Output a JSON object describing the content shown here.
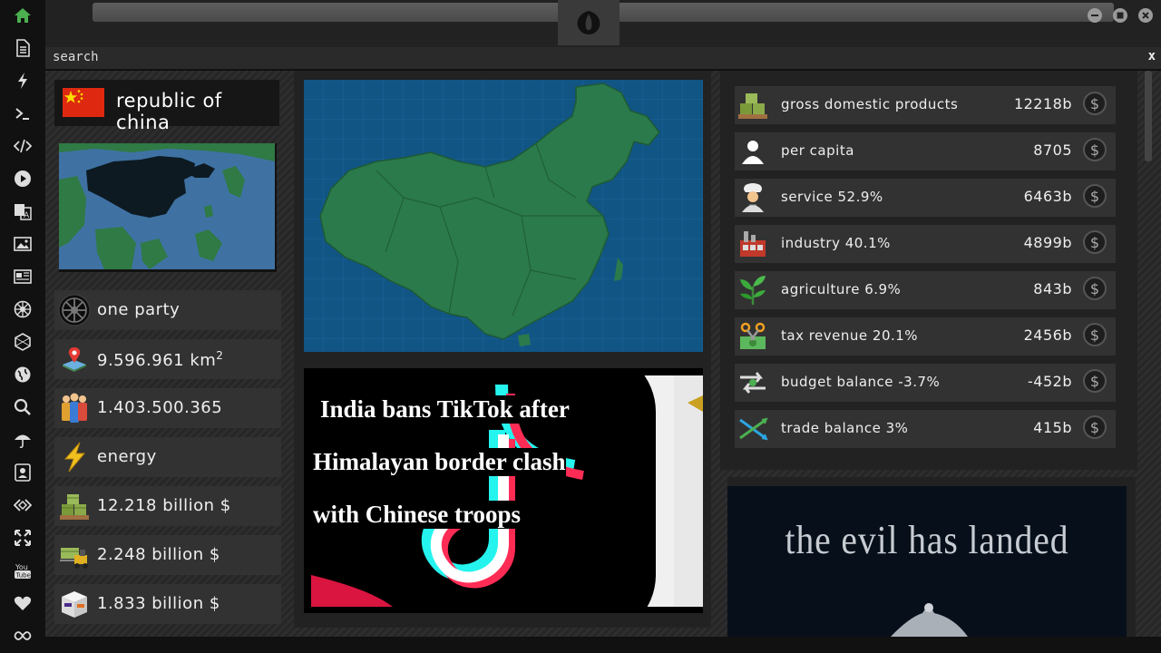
{
  "sidebar": {
    "items": [
      {
        "icon": "home-icon"
      },
      {
        "icon": "document-icon"
      },
      {
        "icon": "lightning-icon"
      },
      {
        "icon": "terminal-icon"
      },
      {
        "icon": "code-icon"
      },
      {
        "icon": "play-icon"
      },
      {
        "icon": "translate-icon"
      },
      {
        "icon": "image-icon"
      },
      {
        "icon": "news-icon"
      },
      {
        "icon": "galactic-empire-icon"
      },
      {
        "icon": "hexagon-icon"
      },
      {
        "icon": "globe-icon"
      },
      {
        "icon": "search-icon"
      },
      {
        "icon": "umbrella-icon"
      },
      {
        "icon": "contact-icon"
      },
      {
        "icon": "diamond-code-icon"
      },
      {
        "icon": "expand-icon"
      },
      {
        "icon": "youtube-icon"
      },
      {
        "icon": "heart-icon"
      },
      {
        "icon": "infinity-icon"
      }
    ]
  },
  "search": {
    "label": "search",
    "close": "x"
  },
  "country": {
    "name": "republic of china",
    "stats": [
      {
        "icon": "galactic-empire-icon",
        "text": "one party"
      },
      {
        "icon": "map-pin-icon",
        "text": "9.596.961 km",
        "sup": "2"
      },
      {
        "icon": "population-icon",
        "text": "1.403.500.365"
      },
      {
        "icon": "energy-icon",
        "text": "energy"
      },
      {
        "icon": "money-pallet-icon",
        "text": "12.218 billion $"
      },
      {
        "icon": "forklift-money-icon",
        "text": "2.248 billion $"
      },
      {
        "icon": "shipping-box-icon",
        "text": "1.833 billion $"
      }
    ]
  },
  "news": {
    "lines": [
      "India bans TikTok after",
      "Himalayan border clash",
      "with Chinese troops"
    ]
  },
  "economy": [
    {
      "icon": "money-pallet-icon",
      "label": "gross domestic products",
      "value": "12218b"
    },
    {
      "icon": "person-icon",
      "label": "per capita",
      "value": "8705"
    },
    {
      "icon": "chef-icon",
      "label": "service 52.9%",
      "value": "6463b"
    },
    {
      "icon": "factory-icon",
      "label": "industry 40.1%",
      "value": "4899b"
    },
    {
      "icon": "plant-icon",
      "label": "agriculture 6.9%",
      "value": "843b"
    },
    {
      "icon": "scissors-money-icon",
      "label": "tax revenue 20.1%",
      "value": "2456b"
    },
    {
      "icon": "balance-arrows-icon",
      "label": "budget balance -3.7%",
      "value": "-452b"
    },
    {
      "icon": "trade-cross-icon",
      "label": "trade balance 3%",
      "value": "415b"
    }
  ],
  "dollar_symbol": "$",
  "promo": {
    "text": "the evil has landed"
  },
  "colors": {
    "accent_green": "#2e7d4a",
    "map_ocean": "#115585",
    "map_land": "#2b7a4b",
    "flag_red": "#de2910",
    "flag_yellow": "#ffde00"
  }
}
